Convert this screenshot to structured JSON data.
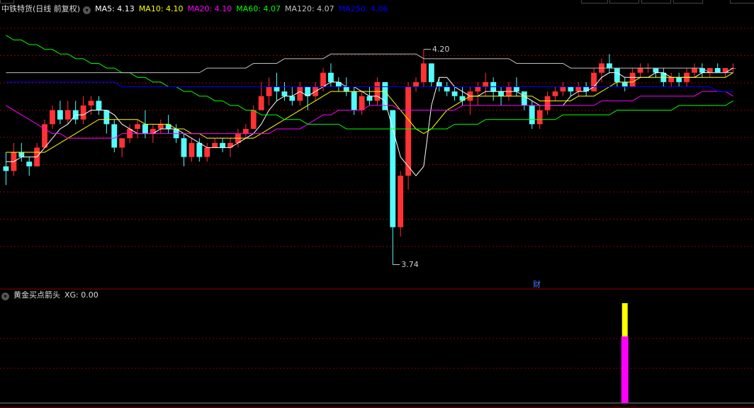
{
  "header": {
    "stock_title": "中铁特货(日线 前复权)",
    "ma_legend": [
      {
        "label": "MA5: 4.13",
        "color": "#ffffff"
      },
      {
        "label": "MA10: 4.10",
        "color": "#ffff00"
      },
      {
        "label": "MA20: 4.10",
        "color": "#ff00ff"
      },
      {
        "label": "MA60: 4.07",
        "color": "#00ff00"
      },
      {
        "label": "MA120: 4.07",
        "color": "#c0c0c0"
      },
      {
        "label": "MA250: 4.06",
        "color": "#0000ff"
      }
    ]
  },
  "annotations": {
    "high_label": "4.20",
    "low_label": "3.74",
    "event_badge": "财"
  },
  "indicator_panel": {
    "title": "黄金买点箭头",
    "xg_label": "XG: 0.00"
  },
  "colors": {
    "up_candle": "#ff3232",
    "down_candle": "#54fcfc",
    "grid": "#8b0000",
    "panel_border": "#8b0000",
    "xg_magenta": "#ff00ff",
    "xg_yellow": "#ffff00"
  },
  "chart_data": {
    "type": "candlestick",
    "price_range": [
      3.7,
      4.26
    ],
    "candles": [
      [
        3.95,
        3.98,
        3.91,
        3.94
      ],
      [
        3.94,
        4.0,
        3.93,
        3.98
      ],
      [
        3.98,
        4.0,
        3.96,
        3.97
      ],
      [
        3.96,
        3.97,
        3.93,
        3.95
      ],
      [
        3.95,
        4.0,
        3.95,
        3.99
      ],
      [
        3.99,
        4.05,
        3.99,
        4.04
      ],
      [
        4.04,
        4.08,
        4.03,
        4.07
      ],
      [
        4.07,
        4.09,
        4.04,
        4.05
      ],
      [
        4.05,
        4.09,
        4.04,
        4.07
      ],
      [
        4.07,
        4.09,
        4.04,
        4.05
      ],
      [
        4.05,
        4.1,
        4.04,
        4.08
      ],
      [
        4.08,
        4.1,
        4.06,
        4.09
      ],
      [
        4.09,
        4.1,
        4.06,
        4.07
      ],
      [
        4.07,
        4.07,
        4.02,
        4.04
      ],
      [
        4.04,
        4.05,
        3.98,
        3.99
      ],
      [
        3.99,
        4.01,
        3.97,
        4.01
      ],
      [
        4.01,
        4.04,
        4.0,
        4.03
      ],
      [
        4.03,
        4.05,
        4.01,
        4.04
      ],
      [
        4.04,
        4.07,
        4.01,
        4.02
      ],
      [
        4.02,
        4.04,
        4.0,
        4.03
      ],
      [
        4.03,
        4.05,
        4.02,
        4.04
      ],
      [
        4.04,
        4.06,
        4.02,
        4.03
      ],
      [
        4.03,
        4.04,
        4.0,
        4.01
      ],
      [
        4.01,
        4.02,
        3.95,
        3.97
      ],
      [
        3.97,
        4.01,
        3.96,
        4.0
      ],
      [
        4.0,
        4.01,
        3.96,
        3.97
      ],
      [
        3.97,
        4.0,
        3.96,
        3.99
      ],
      [
        3.99,
        4.01,
        3.99,
        4.0
      ],
      [
        4.0,
        4.01,
        3.98,
        3.99
      ],
      [
        3.99,
        4.01,
        3.97,
        4.0
      ],
      [
        4.0,
        4.03,
        3.99,
        4.02
      ],
      [
        4.02,
        4.04,
        4.01,
        4.03
      ],
      [
        4.03,
        4.08,
        4.03,
        4.07
      ],
      [
        4.07,
        4.13,
        4.07,
        4.1
      ],
      [
        4.1,
        4.14,
        4.08,
        4.12
      ],
      [
        4.12,
        4.15,
        4.09,
        4.11
      ],
      [
        4.11,
        4.13,
        4.09,
        4.1
      ],
      [
        4.1,
        4.12,
        4.08,
        4.09
      ],
      [
        4.09,
        4.13,
        4.08,
        4.12
      ],
      [
        4.12,
        4.12,
        4.07,
        4.1
      ],
      [
        4.1,
        4.13,
        4.09,
        4.12
      ],
      [
        4.12,
        4.16,
        4.11,
        4.15
      ],
      [
        4.15,
        4.17,
        4.12,
        4.13
      ],
      [
        4.13,
        4.14,
        4.11,
        4.12
      ],
      [
        4.12,
        4.14,
        4.1,
        4.11
      ],
      [
        4.11,
        4.12,
        4.06,
        4.07
      ],
      [
        4.07,
        4.11,
        4.06,
        4.1
      ],
      [
        4.1,
        4.12,
        4.08,
        4.09
      ],
      [
        4.09,
        4.14,
        4.08,
        4.13
      ],
      [
        4.13,
        4.13,
        4.07,
        4.07
      ],
      [
        4.07,
        4.07,
        3.74,
        3.82
      ],
      [
        3.82,
        3.94,
        3.8,
        3.93
      ],
      [
        3.93,
        4.13,
        3.9,
        4.12
      ],
      [
        4.12,
        4.14,
        4.11,
        4.13
      ],
      [
        4.13,
        4.2,
        4.12,
        4.17
      ],
      [
        4.17,
        4.17,
        4.12,
        4.13
      ],
      [
        4.13,
        4.14,
        4.11,
        4.12
      ],
      [
        4.12,
        4.13,
        4.1,
        4.11
      ],
      [
        4.11,
        4.12,
        4.09,
        4.1
      ],
      [
        4.1,
        4.12,
        4.08,
        4.09
      ],
      [
        4.09,
        4.12,
        4.06,
        4.11
      ],
      [
        4.11,
        4.13,
        4.08,
        4.12
      ],
      [
        4.12,
        4.15,
        4.1,
        4.13
      ],
      [
        4.13,
        4.14,
        4.09,
        4.11
      ],
      [
        4.11,
        4.12,
        4.08,
        4.1
      ],
      [
        4.1,
        4.13,
        4.09,
        4.12
      ],
      [
        4.12,
        4.14,
        4.1,
        4.11
      ],
      [
        4.11,
        4.11,
        4.07,
        4.08
      ],
      [
        4.08,
        4.09,
        4.03,
        4.04
      ],
      [
        4.04,
        4.08,
        4.03,
        4.07
      ],
      [
        4.07,
        4.11,
        4.06,
        4.1
      ],
      [
        4.1,
        4.12,
        4.09,
        4.11
      ],
      [
        4.11,
        4.13,
        4.1,
        4.12
      ],
      [
        4.12,
        4.12,
        4.1,
        4.11
      ],
      [
        4.11,
        4.13,
        4.1,
        4.12
      ],
      [
        4.12,
        4.13,
        4.1,
        4.11
      ],
      [
        4.11,
        4.16,
        4.11,
        4.15
      ],
      [
        4.15,
        4.18,
        4.13,
        4.17
      ],
      [
        4.17,
        4.19,
        4.15,
        4.16
      ],
      [
        4.16,
        4.16,
        4.12,
        4.13
      ],
      [
        4.13,
        4.14,
        4.11,
        4.12
      ],
      [
        4.12,
        4.16,
        4.12,
        4.15
      ],
      [
        4.15,
        4.17,
        4.14,
        4.16
      ],
      [
        4.16,
        4.17,
        4.15,
        4.16
      ],
      [
        4.16,
        4.16,
        4.14,
        4.15
      ],
      [
        4.15,
        4.16,
        4.12,
        4.13
      ],
      [
        4.13,
        4.15,
        4.12,
        4.14
      ],
      [
        4.14,
        4.15,
        4.12,
        4.13
      ],
      [
        4.13,
        4.16,
        4.12,
        4.15
      ],
      [
        4.15,
        4.17,
        4.14,
        4.16
      ],
      [
        4.16,
        4.17,
        4.14,
        4.15
      ],
      [
        4.15,
        4.16,
        4.14,
        4.16
      ],
      [
        4.16,
        4.17,
        4.15,
        4.15
      ],
      [
        4.15,
        4.16,
        4.14,
        4.16
      ],
      [
        4.16,
        4.17,
        4.15,
        4.16
      ]
    ],
    "ma5": [
      3.96,
      3.96,
      3.97,
      3.97,
      3.97,
      3.99,
      4.01,
      4.03,
      4.04,
      4.06,
      4.06,
      4.07,
      4.07,
      4.07,
      4.06,
      4.04,
      4.03,
      4.02,
      4.02,
      4.02,
      4.03,
      4.03,
      4.03,
      4.02,
      4.01,
      4.0,
      3.99,
      3.99,
      3.99,
      3.99,
      4.0,
      4.01,
      4.02,
      4.04,
      4.07,
      4.09,
      4.1,
      4.1,
      4.11,
      4.1,
      4.11,
      4.12,
      4.13,
      4.13,
      4.12,
      4.12,
      4.11,
      4.1,
      4.1,
      4.09,
      4.03,
      3.97,
      3.95,
      3.93,
      3.95,
      4.08,
      4.14,
      4.14,
      4.12,
      4.11,
      4.1,
      4.1,
      4.11,
      4.11,
      4.11,
      4.11,
      4.11,
      4.1,
      4.09,
      4.08,
      4.08,
      4.08,
      4.08,
      4.1,
      4.11,
      4.11,
      4.12,
      4.14,
      4.15,
      4.15,
      4.14,
      4.14,
      4.14,
      4.14,
      4.15,
      4.15,
      4.14,
      4.14,
      4.14,
      4.14,
      4.15,
      4.15,
      4.15,
      4.15,
      4.16
    ],
    "ma10": [
      3.98,
      3.98,
      3.98,
      3.98,
      3.98,
      3.98,
      3.99,
      4.0,
      4.01,
      4.02,
      4.03,
      4.04,
      4.05,
      4.05,
      4.05,
      4.05,
      4.05,
      4.05,
      4.04,
      4.04,
      4.04,
      4.04,
      4.03,
      4.03,
      4.02,
      4.02,
      4.01,
      4.01,
      4.01,
      4.01,
      4.01,
      4.01,
      4.01,
      4.02,
      4.03,
      4.04,
      4.05,
      4.06,
      4.07,
      4.08,
      4.09,
      4.1,
      4.11,
      4.11,
      4.11,
      4.11,
      4.11,
      4.11,
      4.11,
      4.11,
      4.09,
      4.07,
      4.05,
      4.03,
      4.02,
      4.03,
      4.05,
      4.07,
      4.08,
      4.09,
      4.1,
      4.1,
      4.1,
      4.1,
      4.1,
      4.1,
      4.1,
      4.1,
      4.1,
      4.09,
      4.09,
      4.09,
      4.09,
      4.09,
      4.1,
      4.1,
      4.1,
      4.11,
      4.12,
      4.13,
      4.13,
      4.13,
      4.14,
      4.14,
      4.14,
      4.14,
      4.14,
      4.14,
      4.14,
      4.14,
      4.14,
      4.14,
      4.14,
      4.14,
      4.15
    ],
    "ma20": [
      4.08,
      4.07,
      4.06,
      4.05,
      4.04,
      4.03,
      4.02,
      4.02,
      4.01,
      4.01,
      4.01,
      4.01,
      4.01,
      4.01,
      4.01,
      4.02,
      4.02,
      4.02,
      4.02,
      4.02,
      4.02,
      4.02,
      4.02,
      4.02,
      4.02,
      4.02,
      4.02,
      4.02,
      4.02,
      4.02,
      4.02,
      4.02,
      4.02,
      4.02,
      4.02,
      4.03,
      4.03,
      4.03,
      4.03,
      4.04,
      4.05,
      4.06,
      4.06,
      4.07,
      4.07,
      4.07,
      4.07,
      4.08,
      4.08,
      4.08,
      4.08,
      4.07,
      4.07,
      4.07,
      4.07,
      4.07,
      4.07,
      4.07,
      4.07,
      4.08,
      4.08,
      4.08,
      4.08,
      4.08,
      4.08,
      4.08,
      4.08,
      4.08,
      4.08,
      4.08,
      4.08,
      4.08,
      4.08,
      4.08,
      4.08,
      4.08,
      4.08,
      4.09,
      4.09,
      4.09,
      4.09,
      4.09,
      4.1,
      4.1,
      4.1,
      4.1,
      4.1,
      4.1,
      4.1,
      4.1,
      4.11,
      4.11,
      4.11,
      4.11,
      4.1
    ],
    "ma60": [
      4.23,
      4.22,
      4.22,
      4.21,
      4.21,
      4.2,
      4.2,
      4.19,
      4.19,
      4.18,
      4.18,
      4.17,
      4.17,
      4.16,
      4.16,
      4.15,
      4.15,
      4.14,
      4.14,
      4.13,
      4.13,
      4.12,
      4.12,
      4.11,
      4.11,
      4.1,
      4.1,
      4.09,
      4.09,
      4.08,
      4.08,
      4.07,
      4.07,
      4.06,
      4.06,
      4.06,
      4.05,
      4.05,
      4.05,
      4.04,
      4.04,
      4.04,
      4.04,
      4.04,
      4.03,
      4.03,
      4.03,
      4.03,
      4.03,
      4.03,
      4.03,
      4.03,
      4.03,
      4.03,
      4.03,
      4.03,
      4.03,
      4.03,
      4.04,
      4.04,
      4.04,
      4.04,
      4.05,
      4.05,
      4.05,
      4.05,
      4.05,
      4.05,
      4.05,
      4.05,
      4.05,
      4.05,
      4.06,
      4.06,
      4.06,
      4.06,
      4.06,
      4.06,
      4.06,
      4.07,
      4.07,
      4.07,
      4.07,
      4.07,
      4.07,
      4.07,
      4.07,
      4.08,
      4.08,
      4.08,
      4.08,
      4.08,
      4.08,
      4.08,
      4.09
    ],
    "ma120": [
      4.15,
      4.15,
      4.15,
      4.15,
      4.15,
      4.15,
      4.15,
      4.15,
      4.15,
      4.15,
      4.15,
      4.15,
      4.15,
      4.15,
      4.15,
      4.15,
      4.15,
      4.15,
      4.15,
      4.15,
      4.15,
      4.15,
      4.15,
      4.15,
      4.15,
      4.15,
      4.16,
      4.16,
      4.16,
      4.16,
      4.16,
      4.16,
      4.17,
      4.17,
      4.17,
      4.17,
      4.18,
      4.18,
      4.18,
      4.18,
      4.18,
      4.18,
      4.19,
      4.19,
      4.19,
      4.19,
      4.19,
      4.19,
      4.19,
      4.19,
      4.19,
      4.19,
      4.19,
      4.19,
      4.18,
      4.18,
      4.18,
      4.18,
      4.18,
      4.18,
      4.18,
      4.18,
      4.18,
      4.18,
      4.18,
      4.18,
      4.17,
      4.17,
      4.17,
      4.17,
      4.17,
      4.17,
      4.17,
      4.16,
      4.16,
      4.16,
      4.16,
      4.16,
      4.16,
      4.16,
      4.16,
      4.16,
      4.16,
      4.16,
      4.16,
      4.16,
      4.16,
      4.16,
      4.16,
      4.16,
      4.16,
      4.15,
      4.15,
      4.15,
      4.15
    ],
    "ma250": [
      4.13,
      4.13,
      4.13,
      4.13,
      4.13,
      4.13,
      4.13,
      4.13,
      4.13,
      4.13,
      4.13,
      4.13,
      4.13,
      4.13,
      4.13,
      4.12,
      4.12,
      4.12,
      4.12,
      4.12,
      4.12,
      4.12,
      4.12,
      4.12,
      4.12,
      4.12,
      4.12,
      4.12,
      4.12,
      4.12,
      4.12,
      4.12,
      4.12,
      4.12,
      4.12,
      4.12,
      4.12,
      4.12,
      4.12,
      4.12,
      4.12,
      4.12,
      4.12,
      4.12,
      4.12,
      4.12,
      4.12,
      4.12,
      4.12,
      4.12,
      4.12,
      4.12,
      4.12,
      4.12,
      4.12,
      4.12,
      4.12,
      4.12,
      4.12,
      4.12,
      4.12,
      4.12,
      4.12,
      4.12,
      4.12,
      4.12,
      4.12,
      4.12,
      4.12,
      4.12,
      4.12,
      4.12,
      4.12,
      4.12,
      4.12,
      4.12,
      4.12,
      4.12,
      4.12,
      4.12,
      4.12,
      4.12,
      4.12,
      4.12,
      4.12,
      4.12,
      4.12,
      4.12,
      4.12,
      4.12,
      4.12,
      4.12,
      4.11,
      4.11,
      4.11
    ],
    "xg_signal": {
      "index": 80,
      "magenta_value": 1.0,
      "yellow_value": 0.5
    }
  }
}
